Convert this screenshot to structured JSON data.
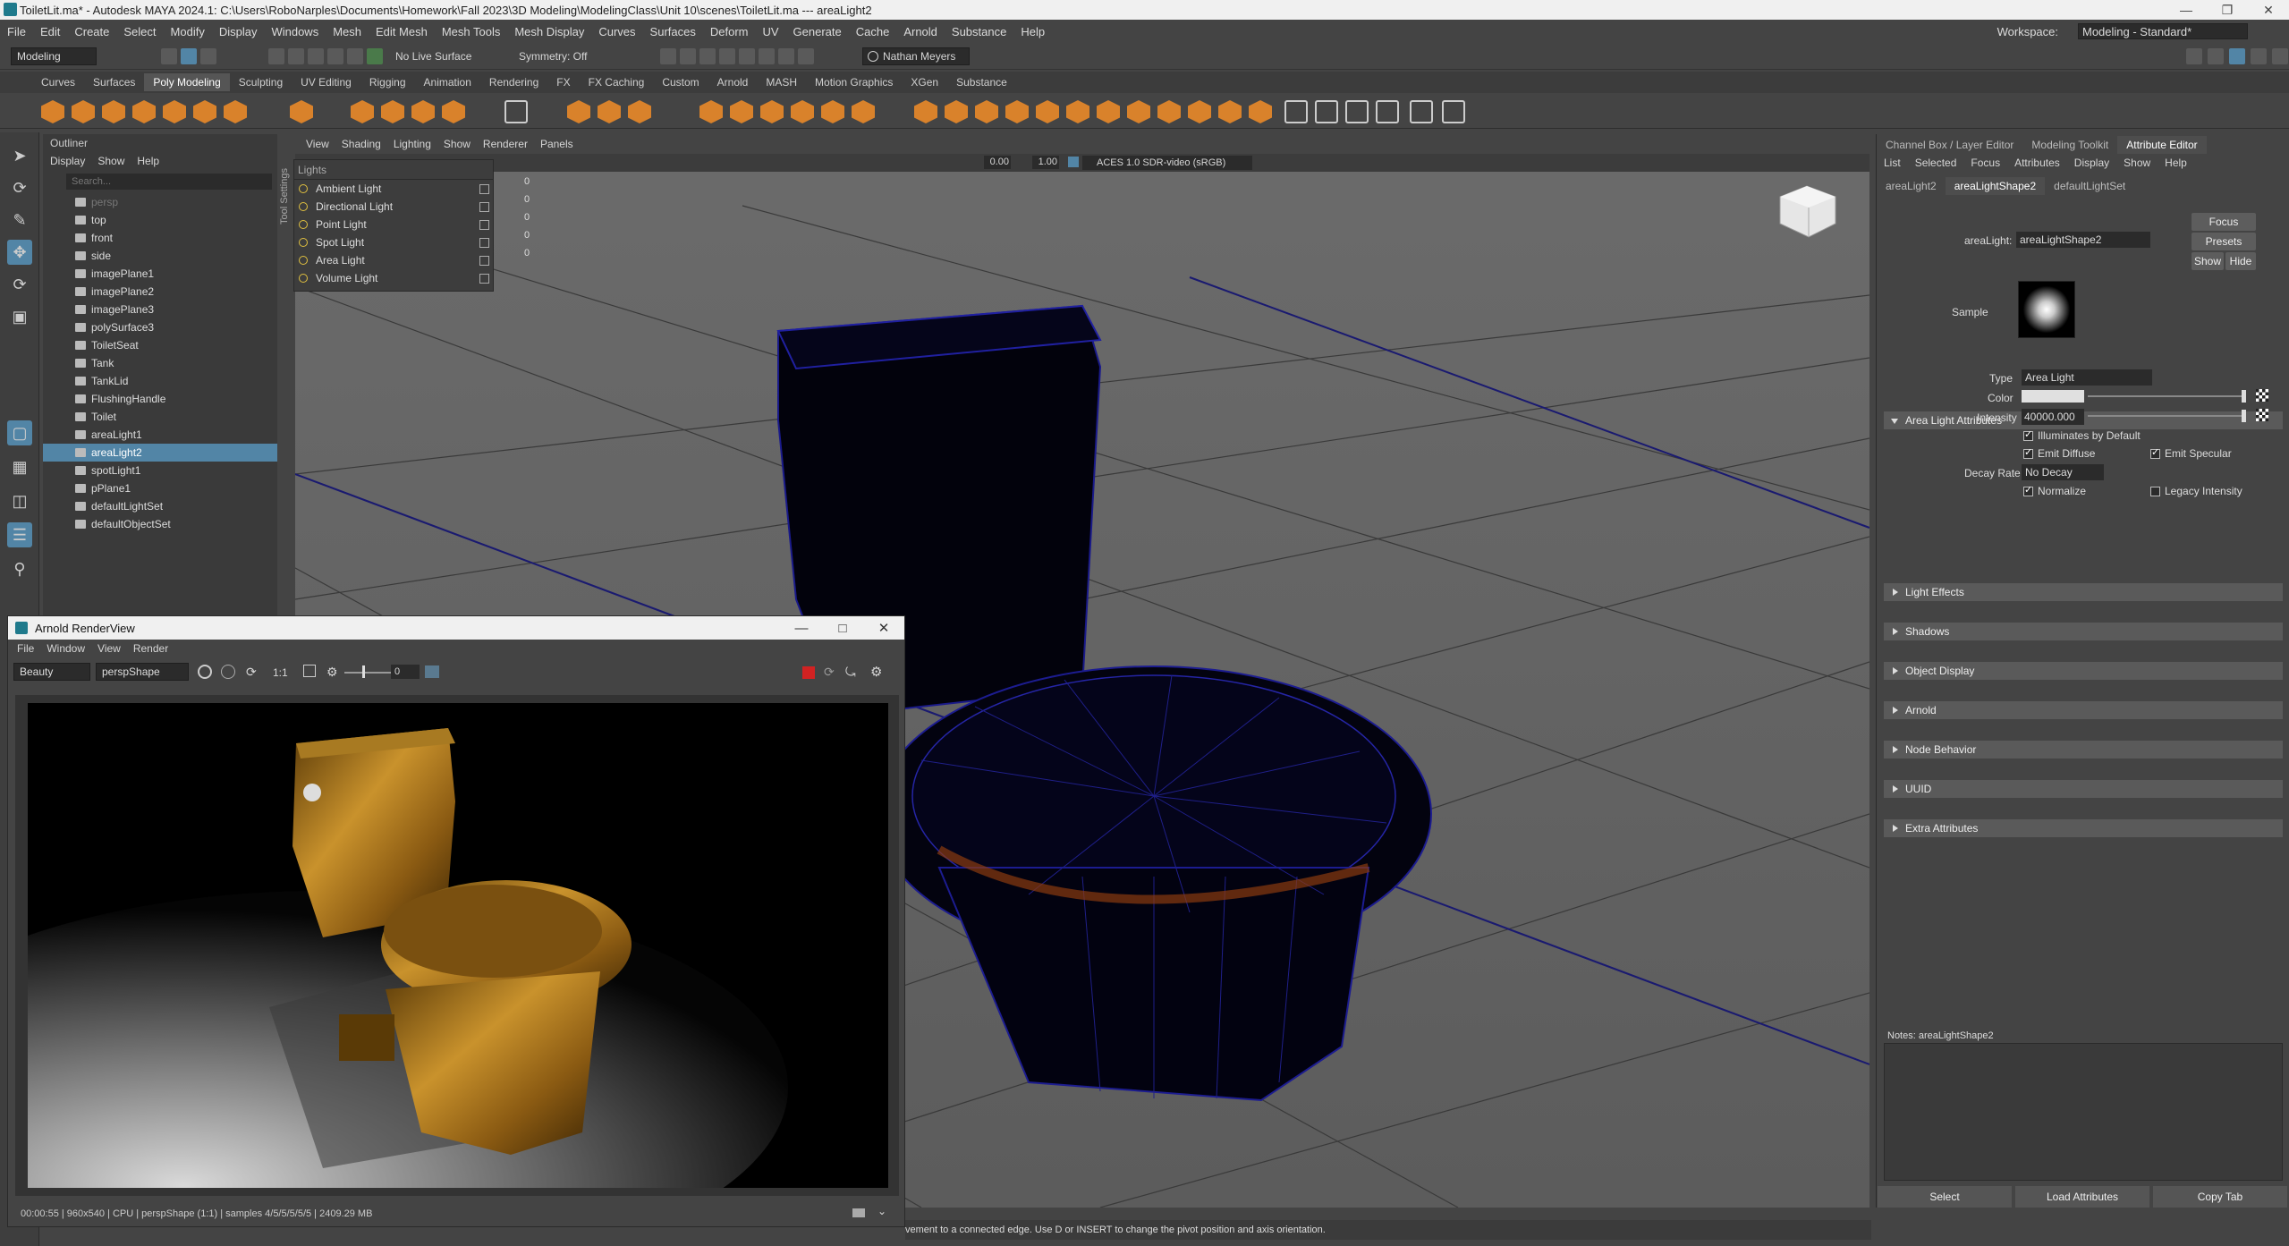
{
  "window": {
    "title": "ToiletLit.ma* - Autodesk MAYA 2024.1: C:\\Users\\RoboNarples\\Documents\\Homework\\Fall 2023\\3D Modeling\\ModelingClass\\Unit 10\\scenes\\ToiletLit.ma  ---  areaLight2"
  },
  "menubar": {
    "items": [
      "File",
      "Edit",
      "Create",
      "Select",
      "Modify",
      "Display",
      "Windows",
      "Mesh",
      "Edit Mesh",
      "Mesh Tools",
      "Mesh Display",
      "Curves",
      "Surfaces",
      "Deform",
      "UV",
      "Generate",
      "Cache",
      "Arnold",
      "Substance",
      "Help"
    ],
    "workspace_label": "Workspace:",
    "workspace_value": "Modeling - Standard*"
  },
  "statusline": {
    "mode": "Modeling",
    "live_surface": "No Live Surface",
    "symmetry": "Symmetry: Off",
    "user": "Nathan Meyers"
  },
  "shelf": {
    "tabs": [
      "Curves",
      "Surfaces",
      "Poly Modeling",
      "Sculpting",
      "UV Editing",
      "Rigging",
      "Animation",
      "Rendering",
      "FX",
      "FX Caching",
      "Custom",
      "Arnold",
      "MASH",
      "Motion Graphics",
      "XGen",
      "Substance"
    ],
    "active_tab": "Poly Modeling"
  },
  "outliner": {
    "title": "Outliner",
    "menu": [
      "Display",
      "Show",
      "Help"
    ],
    "search_placeholder": "Search...",
    "items": [
      {
        "label": "persp",
        "state": "dim"
      },
      {
        "label": "top",
        "state": ""
      },
      {
        "label": "front",
        "state": ""
      },
      {
        "label": "side",
        "state": ""
      },
      {
        "label": "imagePlane1",
        "state": ""
      },
      {
        "label": "imagePlane2",
        "state": ""
      },
      {
        "label": "imagePlane3",
        "state": ""
      },
      {
        "label": "polySurface3",
        "state": ""
      },
      {
        "label": "ToiletSeat",
        "state": ""
      },
      {
        "label": "Tank",
        "state": ""
      },
      {
        "label": "TankLid",
        "state": ""
      },
      {
        "label": "FlushingHandle",
        "state": ""
      },
      {
        "label": "Toilet",
        "state": ""
      },
      {
        "label": "areaLight1",
        "state": ""
      },
      {
        "label": "areaLight2",
        "state": "sel"
      },
      {
        "label": "spotLight1",
        "state": ""
      },
      {
        "label": "pPlane1",
        "state": ""
      },
      {
        "label": "defaultLightSet",
        "state": ""
      },
      {
        "label": "defaultObjectSet",
        "state": ""
      }
    ]
  },
  "viewport": {
    "menu": [
      "View",
      "Shading",
      "Lighting",
      "Show",
      "Renderer",
      "Panels"
    ],
    "field1": "0.00",
    "field2": "1.00",
    "colorspace": "ACES 1.0 SDR-video (sRGB)",
    "side_label": "Tool Settings"
  },
  "lights_popup": {
    "title": "Lights",
    "items": [
      "Ambient Light",
      "Directional Light",
      "Point Light",
      "Spot Light",
      "Area Light",
      "Volume Light"
    ],
    "counts": [
      "0",
      "0",
      "0",
      "0",
      "0"
    ]
  },
  "right_panel": {
    "tabs": [
      "Channel Box / Layer Editor",
      "Modeling Toolkit",
      "Attribute Editor"
    ],
    "active_tab": "Attribute Editor",
    "menu": [
      "List",
      "Selected",
      "Focus",
      "Attributes",
      "Display",
      "Show",
      "Help"
    ],
    "node_tabs": [
      "areaLight2",
      "areaLightShape2",
      "defaultLightSet"
    ],
    "active_node_tab": "areaLightShape2",
    "node_label": "areaLight:",
    "node_value": "areaLightShape2",
    "buttons": {
      "focus": "Focus",
      "presets": "Presets",
      "show": "Show",
      "hide": "Hide"
    },
    "sample_label": "Sample",
    "area_section": "Area Light Attributes",
    "type_label": "Type",
    "type_value": "Area Light",
    "color_label": "Color",
    "intensity_label": "Intensity",
    "intensity_value": "40000.000",
    "illum_default": "Illuminates by Default",
    "emit_diffuse": "Emit Diffuse",
    "emit_specular": "Emit Specular",
    "decay_label": "Decay Rate",
    "decay_value": "No Decay",
    "normalize": "Normalize",
    "legacy": "Legacy Intensity",
    "sections": [
      "Light Effects",
      "Shadows",
      "Object Display",
      "Arnold",
      "Node Behavior",
      "UUID",
      "Extra Attributes"
    ],
    "notes": "Notes:  areaLightShape2",
    "bottom_buttons": [
      "Select",
      "Load Attributes",
      "Copy Tab"
    ]
  },
  "renderview": {
    "title": "Arnold RenderView",
    "menu": [
      "File",
      "Window",
      "View",
      "Render"
    ],
    "aov": "Beauty",
    "camera": "perspShape",
    "ratio": "1:1",
    "exposure": "0",
    "status": "00:00:55 | 960x540 | CPU | perspShape (1:1) | samples 4/5/5/5/5/5 | 2409.29 MB"
  },
  "helpline": "vement to a connected edge. Use D or INSERT to change the pivot position and axis orientation."
}
